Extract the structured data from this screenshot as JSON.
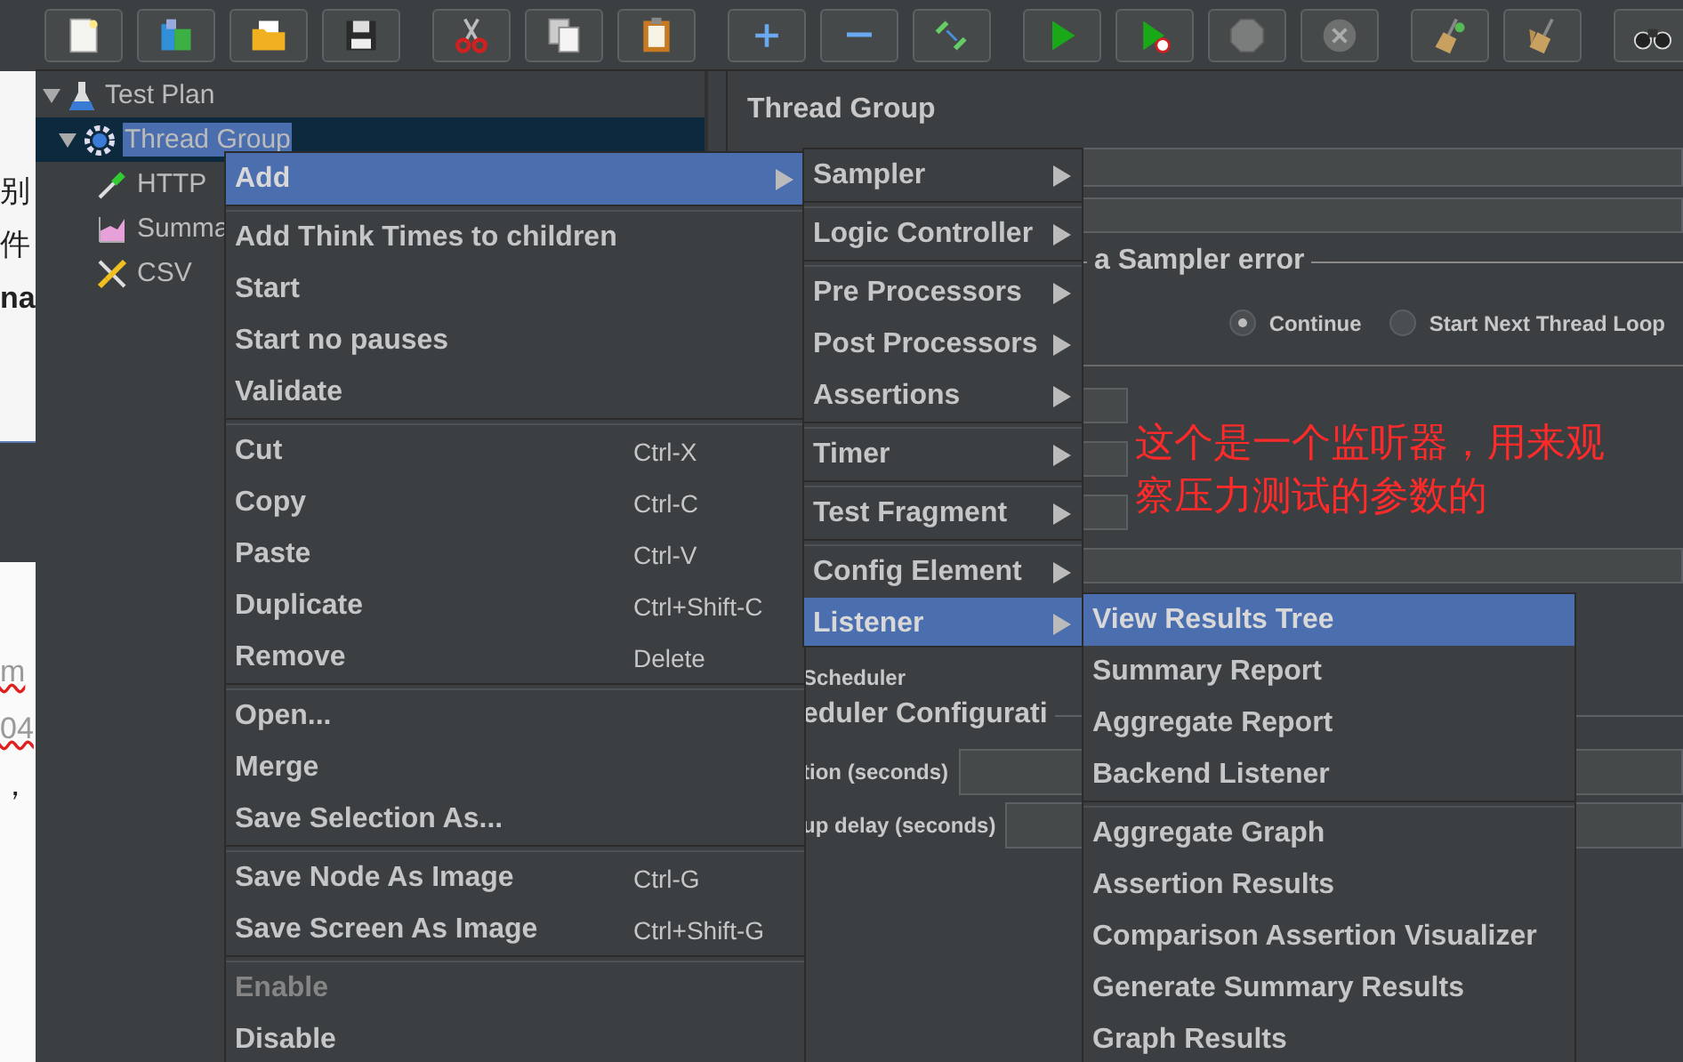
{
  "background_window": {
    "fragments": [
      {
        "text": "别",
        "kind": "plain"
      },
      {
        "text": "件",
        "kind": "plain"
      },
      {
        "text": "na",
        "kind": "bold"
      },
      {
        "text": "m",
        "kind": "faint"
      },
      {
        "text": "04",
        "kind": "faint"
      },
      {
        "text": "，",
        "kind": "plain"
      }
    ]
  },
  "toolbar": {
    "groups": [
      [
        {
          "kind": "new",
          "disabled": false
        },
        {
          "kind": "templates",
          "disabled": false
        },
        {
          "kind": "open",
          "disabled": false
        },
        {
          "kind": "save",
          "disabled": false
        }
      ],
      [
        {
          "kind": "cut",
          "disabled": false
        },
        {
          "kind": "copy",
          "disabled": false
        },
        {
          "kind": "paste",
          "disabled": false
        }
      ],
      [
        {
          "kind": "expand",
          "disabled": false
        },
        {
          "kind": "collapse",
          "disabled": false
        },
        {
          "kind": "toggle",
          "disabled": false
        }
      ],
      [
        {
          "kind": "start",
          "disabled": false
        },
        {
          "kind": "start_no_timers",
          "disabled": false
        },
        {
          "kind": "stop",
          "disabled": true
        },
        {
          "kind": "shutdown",
          "disabled": true
        }
      ],
      [
        {
          "kind": "clear",
          "disabled": false
        },
        {
          "kind": "clear_all",
          "disabled": false
        }
      ],
      [
        {
          "kind": "search",
          "disabled": false
        }
      ]
    ]
  },
  "tree": [
    {
      "label": "Test Plan",
      "kind": "plan",
      "expanded": true,
      "selected": false,
      "children": [
        {
          "label": "Thread Group",
          "kind": "threads",
          "expanded": true,
          "selected": true,
          "children": [
            {
              "label": "HTTP",
              "kind": "sampler",
              "selected": false
            },
            {
              "label": "Summa",
              "kind": "listener",
              "selected": false
            },
            {
              "label": "CSV",
              "kind": "config",
              "selected": false
            }
          ]
        }
      ]
    }
  ],
  "panel": {
    "title": "Thread Group",
    "sampler_error": {
      "legend": "a Sampler error",
      "options": [
        {
          "label": "Continue",
          "selected": true
        },
        {
          "label": "Start Next Thread Loop",
          "selected": false
        }
      ]
    },
    "scheduler_label": "Scheduler",
    "scheduler_config": {
      "legend": "eduler Configurati",
      "fields": [
        {
          "label": "tion (seconds)"
        },
        {
          "label": "up delay (seconds)"
        }
      ]
    }
  },
  "annotation": "这个是一个监听器，用来观察压力测试的参数的",
  "context_menu": [
    {
      "kind": "item",
      "label": "Add",
      "submenu": true,
      "selected": true
    },
    {
      "kind": "separator"
    },
    {
      "kind": "item",
      "label": "Add Think Times to children",
      "selected": false
    },
    {
      "kind": "item",
      "label": "Start",
      "selected": false
    },
    {
      "kind": "item",
      "label": "Start no pauses",
      "selected": false
    },
    {
      "kind": "item",
      "label": "Validate",
      "selected": false
    },
    {
      "kind": "separator"
    },
    {
      "kind": "item",
      "label": "Cut",
      "shortcut": "Ctrl-X",
      "selected": false
    },
    {
      "kind": "item",
      "label": "Copy",
      "shortcut": "Ctrl-C",
      "selected": false
    },
    {
      "kind": "item",
      "label": "Paste",
      "shortcut": "Ctrl-V",
      "selected": false
    },
    {
      "kind": "item",
      "label": "Duplicate",
      "shortcut": "Ctrl+Shift-C",
      "selected": false
    },
    {
      "kind": "item",
      "label": "Remove",
      "shortcut": "Delete",
      "selected": false
    },
    {
      "kind": "separator"
    },
    {
      "kind": "item",
      "label": "Open...",
      "selected": false
    },
    {
      "kind": "item",
      "label": "Merge",
      "selected": false
    },
    {
      "kind": "item",
      "label": "Save Selection As...",
      "selected": false
    },
    {
      "kind": "separator"
    },
    {
      "kind": "item",
      "label": "Save Node As Image",
      "shortcut": "Ctrl-G",
      "selected": false
    },
    {
      "kind": "item",
      "label": "Save Screen As Image",
      "shortcut": "Ctrl+Shift-G",
      "selected": false
    },
    {
      "kind": "separator"
    },
    {
      "kind": "item",
      "label": "Enable",
      "selected": false,
      "disabled": true
    },
    {
      "kind": "item",
      "label": "Disable",
      "selected": false,
      "disabled": false
    }
  ],
  "add_submenu": [
    {
      "kind": "item",
      "label": "Sampler",
      "submenu": true,
      "selected": false
    },
    {
      "kind": "separator"
    },
    {
      "kind": "item",
      "label": "Logic Controller",
      "submenu": true,
      "selected": false
    },
    {
      "kind": "separator"
    },
    {
      "kind": "item",
      "label": "Pre Processors",
      "submenu": true,
      "selected": false
    },
    {
      "kind": "item",
      "label": "Post Processors",
      "submenu": true,
      "selected": false
    },
    {
      "kind": "item",
      "label": "Assertions",
      "submenu": true,
      "selected": false
    },
    {
      "kind": "separator"
    },
    {
      "kind": "item",
      "label": "Timer",
      "submenu": true,
      "selected": false
    },
    {
      "kind": "separator"
    },
    {
      "kind": "item",
      "label": "Test Fragment",
      "submenu": true,
      "selected": false
    },
    {
      "kind": "separator"
    },
    {
      "kind": "item",
      "label": "Config Element",
      "submenu": true,
      "selected": false
    },
    {
      "kind": "item",
      "label": "Listener",
      "submenu": true,
      "selected": true
    }
  ],
  "listener_submenu": [
    {
      "kind": "item",
      "label": "View Results Tree",
      "selected": true
    },
    {
      "kind": "item",
      "label": "Summary Report",
      "selected": false
    },
    {
      "kind": "item",
      "label": "Aggregate Report",
      "selected": false
    },
    {
      "kind": "item",
      "label": "Backend Listener",
      "selected": false
    },
    {
      "kind": "separator"
    },
    {
      "kind": "item",
      "label": "Aggregate Graph",
      "selected": false
    },
    {
      "kind": "item",
      "label": "Assertion Results",
      "selected": false
    },
    {
      "kind": "item",
      "label": "Comparison Assertion Visualizer",
      "selected": false
    },
    {
      "kind": "item",
      "label": "Generate Summary Results",
      "selected": false
    },
    {
      "kind": "item",
      "label": "Graph Results",
      "selected": false
    }
  ]
}
